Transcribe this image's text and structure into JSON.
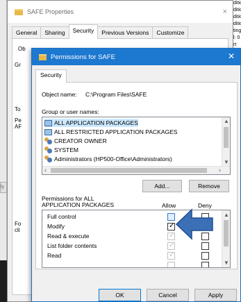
{
  "background": {
    "right_edge_lines": [
      "dition",
      "dition",
      "dition",
      "dition",
      "ting",
      "l: 0 rt"
    ],
    "left_edge_button": "ly"
  },
  "props_dialog": {
    "title": "SAFE Properties",
    "close": "×",
    "tabs": [
      "General",
      "Sharing",
      "Security",
      "Previous Versions",
      "Customize"
    ],
    "active_tab": "Security",
    "ghost_labels": [
      "Ob",
      "Gr",
      "To",
      "Pe",
      "AF",
      "Fo",
      "cli"
    ]
  },
  "perm_dialog": {
    "title": "Permissions for SAFE",
    "close": "✕",
    "tab": "Security",
    "object_name_label": "Object name:",
    "object_name_value": "C:\\Program Files\\SAFE",
    "groups_label": "Group or user names:",
    "groups": [
      {
        "name": "ALL APPLICATION PACKAGES",
        "icon": "package-icon",
        "selected": true
      },
      {
        "name": "ALL RESTRICTED APPLICATION PACKAGES",
        "icon": "package-icon",
        "selected": false
      },
      {
        "name": "CREATOR OWNER",
        "icon": "users-icon",
        "selected": false
      },
      {
        "name": "SYSTEM",
        "icon": "users-icon",
        "selected": false
      },
      {
        "name": "Administrators (HP500-Office\\Administrators)",
        "icon": "users-icon",
        "selected": false
      }
    ],
    "add_label": "Add...",
    "remove_label": "Remove",
    "permissions_label_line1": "Permissions for ALL",
    "permissions_label_line2": "APPLICATION PACKAGES",
    "allow_header": "Allow",
    "deny_header": "Deny",
    "permissions": [
      {
        "name": "Full control",
        "allow": "unchecked-focused",
        "deny": "unchecked"
      },
      {
        "name": "Modify",
        "allow": "checked",
        "deny": "unchecked"
      },
      {
        "name": "Read & execute",
        "allow": "checked-disabled",
        "deny": "unchecked"
      },
      {
        "name": "List folder contents",
        "allow": "checked-disabled",
        "deny": "unchecked"
      },
      {
        "name": "Read",
        "allow": "checked-disabled",
        "deny": "unchecked"
      }
    ],
    "ok_label": "OK",
    "cancel_label": "Cancel",
    "apply_label": "Apply"
  },
  "annotation": {
    "icon": "arrow-left-icon",
    "color": "#3b6fb6"
  },
  "colors": {
    "title_bar": "#1d78d0",
    "selection": "#cce8ff",
    "arrow": "#3b6fb6"
  }
}
